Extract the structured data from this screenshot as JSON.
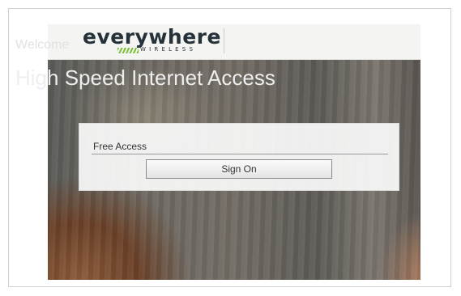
{
  "brand": {
    "name": "everywhere",
    "tagline": "WIRELESS",
    "accent_color": "#7cbf3a"
  },
  "hero": {
    "welcome": "Welcome",
    "headline": "High Speed Internet Access"
  },
  "login_panel": {
    "label": "Free Access",
    "button_label": "Sign On"
  }
}
